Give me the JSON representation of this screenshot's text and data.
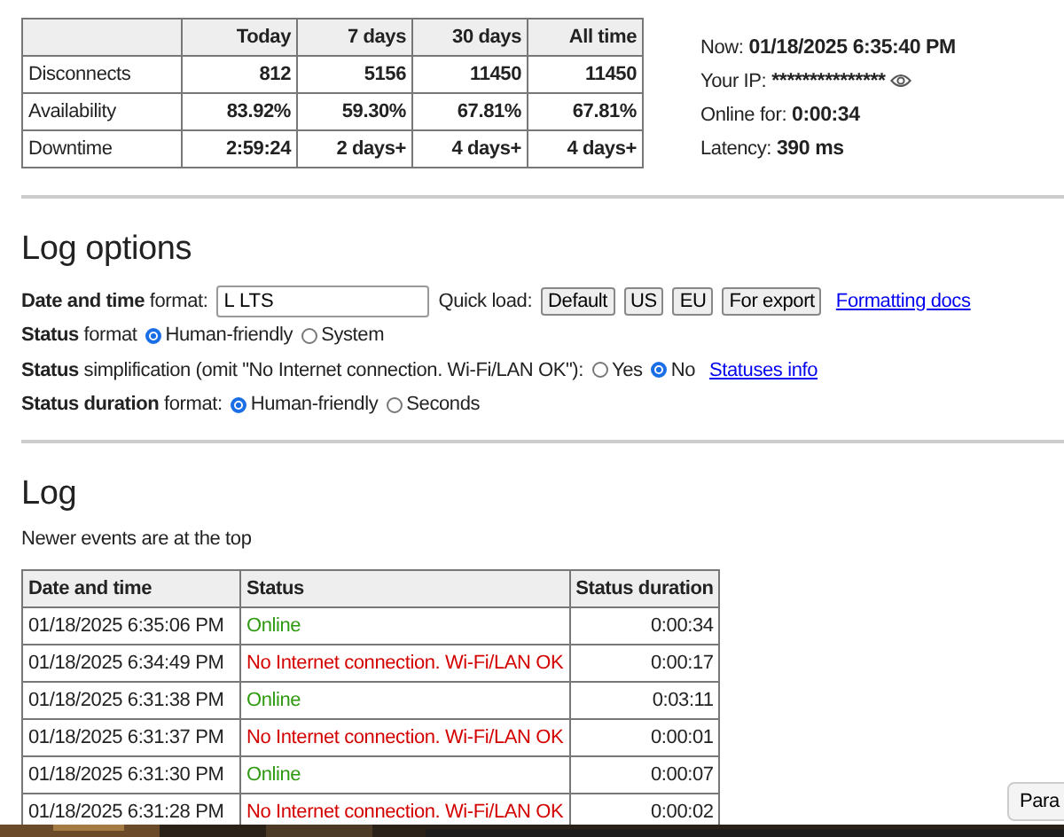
{
  "stats_table": {
    "columns": [
      "Today",
      "7 days",
      "30 days",
      "All time"
    ],
    "rows": [
      {
        "label": "Disconnects",
        "values": [
          "812",
          "5156",
          "11450",
          "11450"
        ]
      },
      {
        "label": "Availability",
        "values": [
          "83.92%",
          "59.30%",
          "67.81%",
          "67.81%"
        ]
      },
      {
        "label": "Downtime",
        "values": [
          "2:59:24",
          "2 days+",
          "4 days+",
          "4 days+"
        ]
      }
    ]
  },
  "info": [
    {
      "label": "Now:",
      "value": "01/18/2025 6:35:40 PM"
    },
    {
      "label": "Your IP:",
      "value": "***************",
      "kind": "masked"
    },
    {
      "label": "Online for:",
      "value": "0:00:34"
    },
    {
      "label": "Latency:",
      "value": "390 ms"
    }
  ],
  "log_options": {
    "title": "Log options",
    "date_format": {
      "label_bold": "Date and time",
      "label": "format:",
      "value": "L LTS",
      "quick_load_label": "Quick load:",
      "buttons": [
        "Default",
        "US",
        "EU",
        "For export"
      ],
      "link": "Formatting docs"
    },
    "radio_rows": [
      {
        "label_bold": "Status",
        "label": "format",
        "options": [
          {
            "label": "Human-friendly",
            "selected": true
          },
          {
            "label": "System",
            "selected": false
          }
        ]
      },
      {
        "label_bold": "Status",
        "label": "simplification (omit \"No Internet connection. Wi-Fi/LAN OK\"):",
        "options": [
          {
            "label": "Yes",
            "selected": false
          },
          {
            "label": "No",
            "selected": true
          }
        ],
        "link": "Statuses info"
      },
      {
        "label_bold": "Status duration",
        "label": "format:",
        "options": [
          {
            "label": "Human-friendly",
            "selected": true
          },
          {
            "label": "Seconds",
            "selected": false
          }
        ]
      }
    ]
  },
  "log": {
    "title": "Log",
    "note": "Newer events are at the top",
    "columns": [
      "Date and time",
      "Status",
      "Status duration"
    ],
    "rows": [
      {
        "time": "01/18/2025 6:35:06 PM",
        "status": "Online",
        "kind": "online",
        "duration": "0:00:34"
      },
      {
        "time": "01/18/2025 6:34:49 PM",
        "status": "No Internet connection. Wi-Fi/LAN OK",
        "kind": "offline",
        "duration": "0:00:17"
      },
      {
        "time": "01/18/2025 6:31:38 PM",
        "status": "Online",
        "kind": "online",
        "duration": "0:03:11"
      },
      {
        "time": "01/18/2025 6:31:37 PM",
        "status": "No Internet connection. Wi-Fi/LAN OK",
        "kind": "offline",
        "duration": "0:00:01"
      },
      {
        "time": "01/18/2025 6:31:30 PM",
        "status": "Online",
        "kind": "online",
        "duration": "0:00:07"
      },
      {
        "time": "01/18/2025 6:31:28 PM",
        "status": "No Internet connection. Wi-Fi/LAN OK",
        "kind": "offline",
        "duration": "0:00:02"
      }
    ]
  },
  "overlay_button": "Para"
}
